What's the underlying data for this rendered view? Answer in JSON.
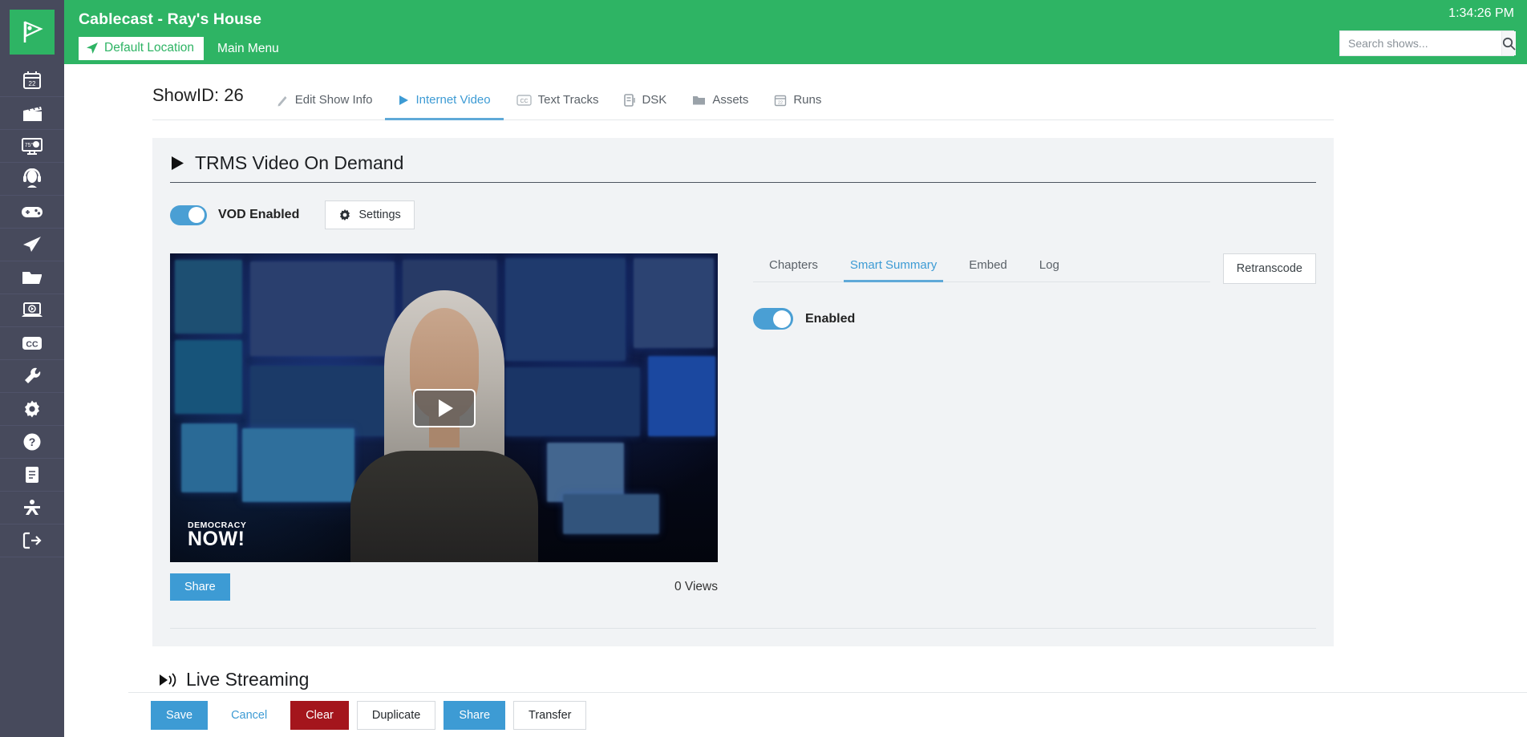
{
  "topbar": {
    "app_title": "Cablecast - Ray's House",
    "location_chip": "Default Location",
    "main_menu": "Main Menu",
    "clock": "1:34:26 PM",
    "search_placeholder": "Search shows...",
    "search_value": "",
    "green": "#2eb464"
  },
  "sidebar": {
    "logo": "cablecast-logo",
    "items": [
      {
        "name": "schedule",
        "icon": "calendar-icon",
        "badge": "22"
      },
      {
        "name": "shows",
        "icon": "clapperboard-icon"
      },
      {
        "name": "digital-signage",
        "icon": "weather-monitor-icon",
        "badge": "75"
      },
      {
        "name": "live-events",
        "icon": "headset-icon"
      },
      {
        "name": "controls",
        "icon": "gamepad-icon"
      },
      {
        "name": "broadcast",
        "icon": "paper-plane-icon"
      },
      {
        "name": "files",
        "icon": "folder-icon"
      },
      {
        "name": "vod",
        "icon": "laptop-play-icon"
      },
      {
        "name": "captions",
        "icon": "cc-icon"
      },
      {
        "name": "tools",
        "icon": "wrench-icon"
      },
      {
        "name": "settings",
        "icon": "gear-icon"
      },
      {
        "name": "help",
        "icon": "question-circle-icon"
      },
      {
        "name": "docs",
        "icon": "book-icon"
      },
      {
        "name": "accessibility",
        "icon": "person-icon"
      },
      {
        "name": "logout",
        "icon": "logout-icon"
      }
    ]
  },
  "show": {
    "show_id_label": "ShowID: 26",
    "tabs": [
      {
        "label": "Edit Show Info",
        "icon": "pencil-icon",
        "active": false
      },
      {
        "label": "Internet Video",
        "icon": "play-icon",
        "active": true
      },
      {
        "label": "Text Tracks",
        "icon": "cc-icon",
        "active": false
      },
      {
        "label": "DSK",
        "icon": "dsk-icon",
        "active": false
      },
      {
        "label": "Assets",
        "icon": "folder-icon",
        "active": false
      },
      {
        "label": "Runs",
        "icon": "calendar-icon",
        "active": false
      }
    ]
  },
  "vod": {
    "section_title": "TRMS Video On Demand",
    "toggle_label": "VOD Enabled",
    "toggle_on": true,
    "settings_label": "Settings",
    "share_label": "Share",
    "views_label": "0 Views",
    "player": {
      "overlay_icon": "play-icon",
      "watermark_line1": "DEMOCRACY",
      "watermark_line2": "NOW!"
    },
    "subtabs": [
      {
        "label": "Chapters",
        "active": false
      },
      {
        "label": "Smart Summary",
        "active": true
      },
      {
        "label": "Embed",
        "active": false
      },
      {
        "label": "Log",
        "active": false
      }
    ],
    "retranscode_label": "Retranscode",
    "summary_toggle_label": "Enabled",
    "summary_toggle_on": true
  },
  "live": {
    "section_title": "Live Streaming"
  },
  "footer": {
    "save": "Save",
    "cancel": "Cancel",
    "clear": "Clear",
    "duplicate": "Duplicate",
    "share": "Share",
    "transfer": "Transfer"
  },
  "colors": {
    "brand_green": "#2eb464",
    "accent_blue": "#3d9bd4",
    "danger_red": "#a4151c",
    "sidebar": "#474a5c",
    "panel_bg": "#f1f3f5"
  }
}
